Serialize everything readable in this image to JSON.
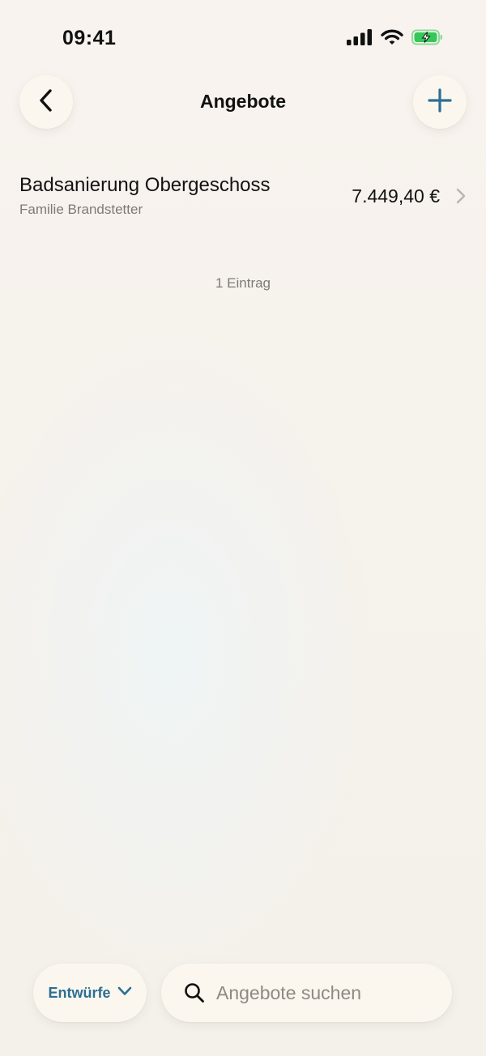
{
  "status_bar": {
    "time": "09:41"
  },
  "nav": {
    "title": "Angebote",
    "back_icon": "chevron-left-icon",
    "add_icon": "plus-icon"
  },
  "offers": [
    {
      "title": "Badsanierung Obergeschoss",
      "customer": "Familie Brandstetter",
      "amount": "7.449,40 €"
    }
  ],
  "list_count": "1 Eintrag",
  "bottom_bar": {
    "filter_label": "Entwürfe",
    "search_placeholder": "Angebote suchen"
  },
  "colors": {
    "accent": "#2c6f93",
    "battery": "#34c759",
    "secondary_text": "#7d7a75"
  }
}
